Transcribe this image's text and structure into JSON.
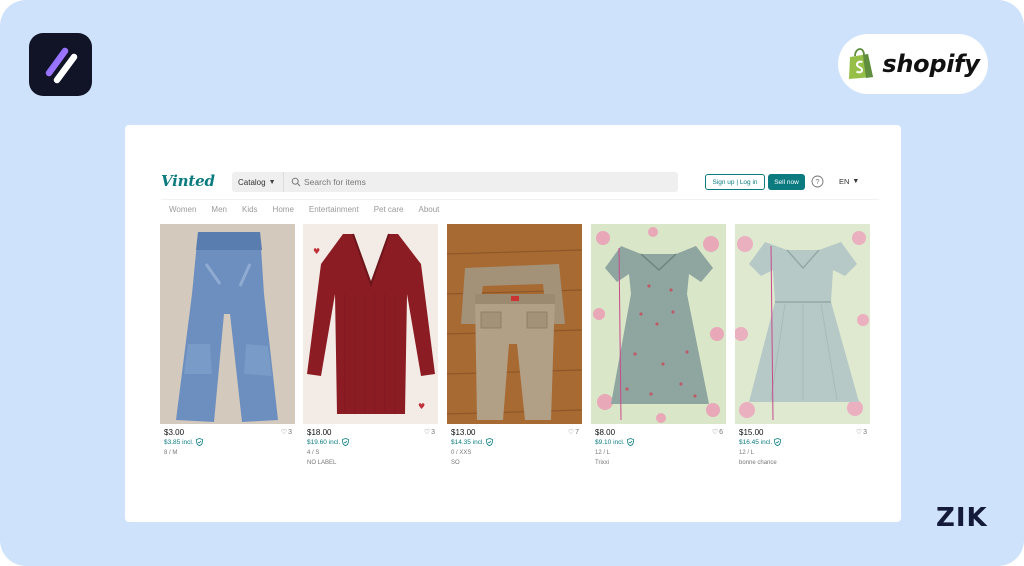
{
  "brand": {
    "shopify": "shopify",
    "zik": "ZIK",
    "accent": "#0b7b80",
    "background": "#cfe2fb"
  },
  "vinted": {
    "logo": "Vinted",
    "catalog_label": "Catalog",
    "search_placeholder": "Search for items",
    "signup_label": "Sign up | Log in",
    "sell_label": "Sell now",
    "help_icon": "question-circle-icon",
    "language": "EN",
    "categories": [
      "Women",
      "Men",
      "Kids",
      "Home",
      "Entertainment",
      "Pet care",
      "About"
    ]
  },
  "items": [
    {
      "price": "$3.00",
      "price_incl": "$3.85 incl.",
      "favorites": "3",
      "size": "8 / M",
      "brand": "",
      "image": "blue flared jeans"
    },
    {
      "price": "$18.00",
      "price_incl": "$19.60 incl.",
      "favorites": "3",
      "size": "4 / S",
      "brand": "NO LABEL",
      "image": "red ribbed v-neck sweater"
    },
    {
      "price": "$13.00",
      "price_incl": "$14.35 incl.",
      "favorites": "7",
      "size": "0 / XXS",
      "brand": "SO",
      "image": "beige cargo pants"
    },
    {
      "price": "$8.00",
      "price_incl": "$9.10 incl.",
      "favorites": "6",
      "size": "12 / L",
      "brand": "Trixxi",
      "image": "floral mini dress"
    },
    {
      "price": "$15.00",
      "price_incl": "$16.45 incl.",
      "favorites": "3",
      "size": "12 / L",
      "brand": "bonne chance",
      "image": "light blue dress"
    }
  ]
}
